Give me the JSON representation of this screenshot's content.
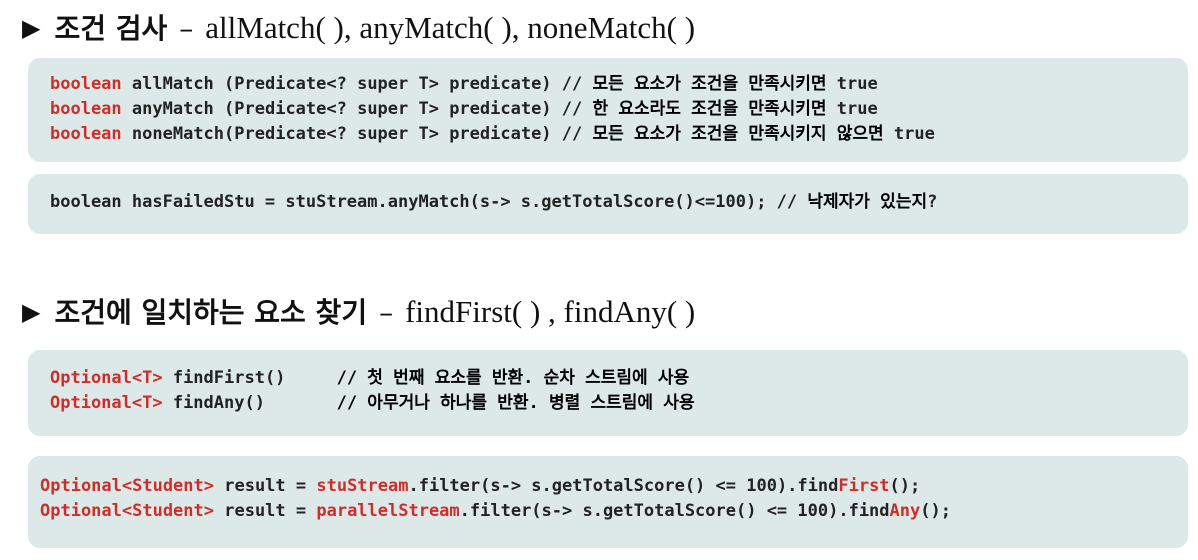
{
  "section1": {
    "bullet": "▶",
    "title": "조건 검사",
    "dash": "–",
    "methods": "allMatch( ), anyMatch( ), noneMatch( )",
    "signatures": [
      {
        "ret": "boolean",
        "name": "allMatch ",
        "params": "(Predicate<? super T> predicate) // ",
        "comment": "모든 요소가 조건을 만족시키면",
        "result": " true"
      },
      {
        "ret": "boolean",
        "name": "anyMatch ",
        "params": "(Predicate<? super T> predicate) // ",
        "comment": "한 요소라도 조건을 만족시키면",
        "result": " true"
      },
      {
        "ret": "boolean",
        "name": "noneMatch",
        "params": "(Predicate<? super T> predicate) // ",
        "comment": "모든 요소가 조건을 만족시키지 않으면",
        "result": " true"
      }
    ],
    "example": {
      "code": "boolean hasFailedStu = stuStream.anyMatch(s-> s.getTotalScore()<=100); // ",
      "comment": "낙제자가 있는지",
      "end": "?"
    }
  },
  "section2": {
    "bullet": "▶",
    "title": "조건에 일치하는 요소 찾기",
    "dash": "–",
    "methods": "findFirst( ) , findAny( )",
    "signatures": [
      {
        "ret": "Optional<T>",
        "name": " findFirst()     ",
        "comment": "// 첫 번째 요소를 반환. 순차 스트림에 사용"
      },
      {
        "ret": "Optional<T>",
        "name": " findAny()       ",
        "comment": "// 아무거나 하나를 반환. 병렬 스트림에 사용"
      }
    ],
    "examples": [
      {
        "type": "Optional<Student>",
        "mid": " result = ",
        "stream": "stuStream",
        "rest": ".filter(s-> s.getTotalScore() <= 100).find",
        "method": "First",
        "end": "();"
      },
      {
        "type": "Optional<Student>",
        "mid": " result = ",
        "stream": "parallelStream",
        "rest": ".filter(s-> s.getTotalScore() <= 100).find",
        "method": "Any",
        "end": "();"
      }
    ]
  }
}
